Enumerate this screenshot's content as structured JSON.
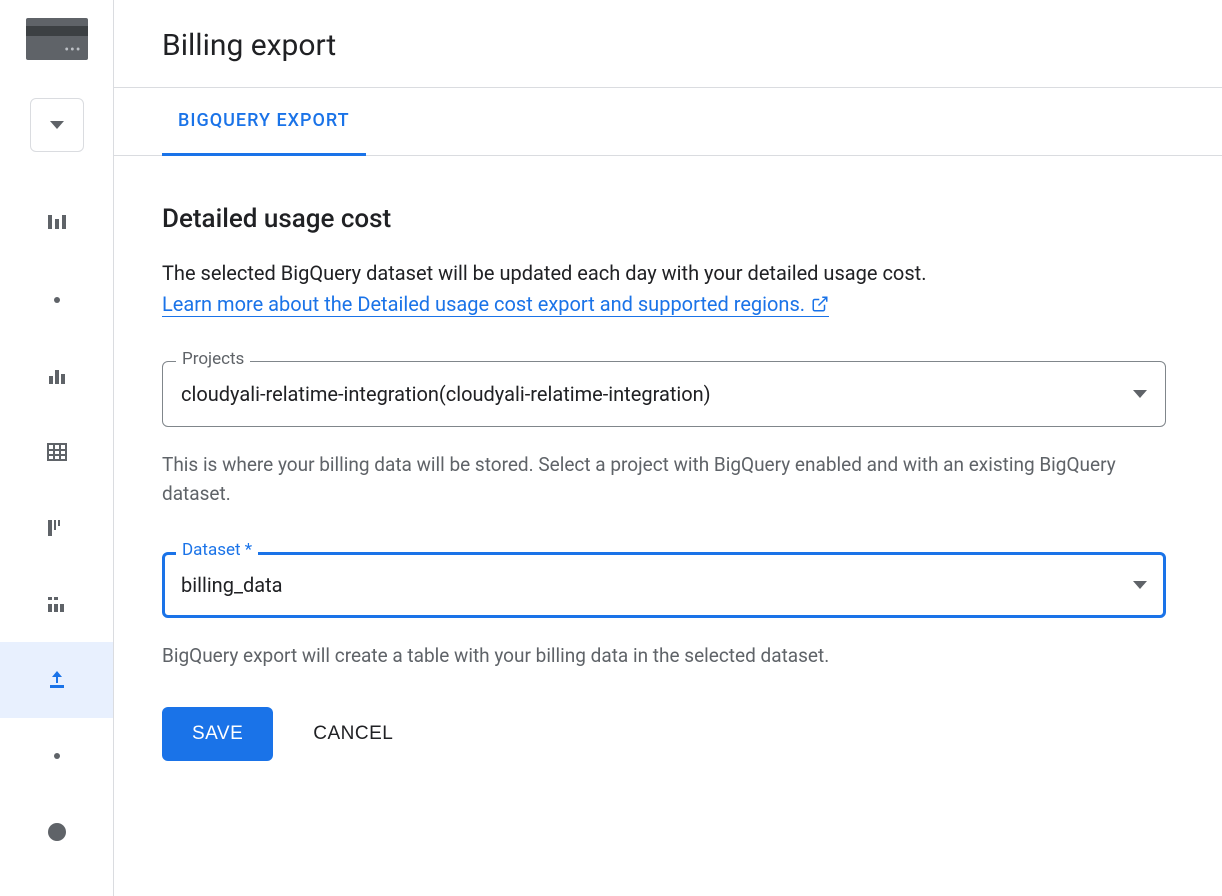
{
  "header": {
    "title": "Billing export"
  },
  "tabs": {
    "active": "BIGQUERY EXPORT"
  },
  "section": {
    "title": "Detailed usage cost",
    "description": "The selected BigQuery dataset will be updated each day with your detailed usage cost.",
    "link_text": "Learn more about the Detailed usage cost export and supported regions."
  },
  "projects": {
    "label": "Projects",
    "value": "cloudyali-relatime-integration(cloudyali-relatime-integration)",
    "helper": "This is where your billing data will be stored. Select a project with BigQuery enabled and with an existing BigQuery dataset."
  },
  "dataset": {
    "label": "Dataset",
    "required_marker": "*",
    "value": "billing_data",
    "helper": "BigQuery export will create a table with your billing data in the selected dataset."
  },
  "buttons": {
    "save": "SAVE",
    "cancel": "CANCEL"
  }
}
